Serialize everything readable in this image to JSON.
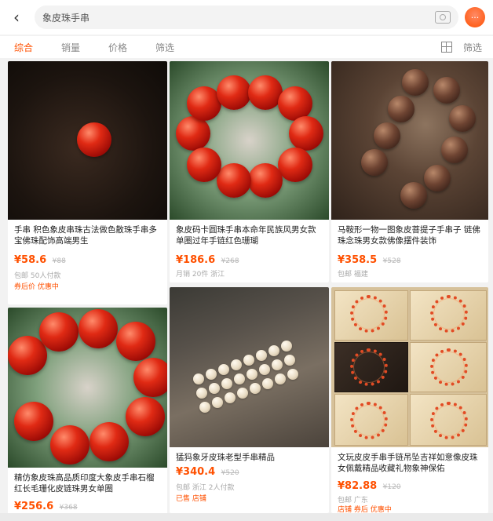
{
  "search": {
    "query": "象皮珠手串"
  },
  "filters": {
    "items": [
      {
        "label": "综合",
        "active": true
      },
      {
        "label": "销量",
        "active": false
      },
      {
        "label": "价格",
        "active": false
      },
      {
        "label": "筛选",
        "active": false
      }
    ],
    "mode_label": "筛选"
  },
  "products": [
    {
      "title": "手串 积色象皮串珠古法做色散珠手串多宝佛珠配饰高端男生",
      "price": "¥58.6",
      "old_price": "¥88",
      "meta": "包邮 50人付款",
      "tag": "券后价 优惠中"
    },
    {
      "title": "象皮码卡圆珠手串本命年民族风男女款单圈过年手链红色珊瑚",
      "price": "¥186.6",
      "old_price": "¥268",
      "meta": "月销 20件 浙江",
      "tag": ""
    },
    {
      "title": "马鞍形一物一图象皮菩提子手串子 链佛珠念珠男女款佛像摆件装饰",
      "price": "¥358.5",
      "old_price": "¥528",
      "meta": "包邮 福建",
      "tag": ""
    },
    {
      "title": "精仿象皮珠高品质印度大象皮手串石榴红长毛珊化皮链珠男女单圈",
      "price": "¥256.6",
      "old_price": "¥368",
      "meta": "",
      "tag": ""
    },
    {
      "title": "猛犸象牙皮珠老型手串精品",
      "price": "¥340.4",
      "old_price": "¥520",
      "meta": "包邮 浙江 2人付款",
      "tag": "已售 店铺"
    },
    {
      "title": "文玩皮皮手串手链吊坠吉祥如意像皮珠女佩戴精品收藏礼物象神保佑",
      "price": "¥82.88",
      "old_price": "¥120",
      "meta": "包邮 广东",
      "tag": "店铺 券后 优惠中"
    }
  ],
  "colors": {
    "accent": "#ff5000",
    "background": "#f2f2f2"
  },
  "icons": {
    "back": "back-arrow-icon",
    "camera": "camera-icon",
    "message": "message-icon",
    "grid": "grid-view-icon",
    "filter": "filter-icon"
  }
}
